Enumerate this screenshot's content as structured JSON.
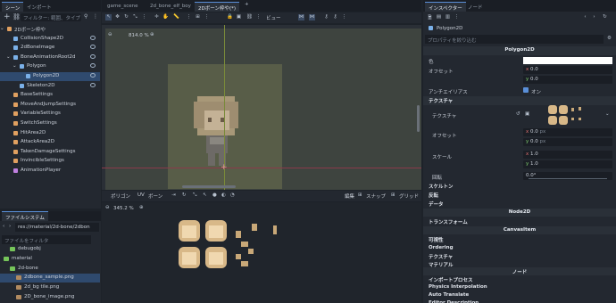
{
  "colors": {
    "accent": "#5a8fd8",
    "bg": "#1d2229",
    "panel": "#232830",
    "viewport": "#4a4f48",
    "selection": "#2f4a6e",
    "green_folder": "#76c55a"
  },
  "top_left_tabs": [
    "シーン",
    "インポート"
  ],
  "filter": {
    "placeholder": "フィルター: 範囲、タイプ"
  },
  "scene_tree": [
    {
      "label": "2Dボーン枠や",
      "depth": 0,
      "color": "#e0a060"
    },
    {
      "label": "CollisionShape2D",
      "depth": 1,
      "color": "#7ab0e8"
    },
    {
      "label": "2dBoneImage",
      "depth": 1,
      "color": "#7ab0e8"
    },
    {
      "label": "BoneAnimationRoot2d",
      "depth": 1,
      "color": "#7ab0e8"
    },
    {
      "label": "Polygon",
      "depth": 2,
      "color": "#7ab0e8"
    },
    {
      "label": "Polygon2D",
      "depth": 3,
      "color": "#7ab0e8",
      "selected": true
    },
    {
      "label": "Skeleton2D",
      "depth": 2,
      "color": "#7ab0e8"
    },
    {
      "label": "BaseSettings",
      "depth": 1,
      "color": "#e0a060"
    },
    {
      "label": "MoveAndJumpSettings",
      "depth": 1,
      "color": "#e0a060"
    },
    {
      "label": "VariableSettings",
      "depth": 1,
      "color": "#e0a060"
    },
    {
      "label": "SwitchSettings",
      "depth": 1,
      "color": "#e0a060"
    },
    {
      "label": "HitArea2D",
      "depth": 1,
      "color": "#e0a060"
    },
    {
      "label": "AttackArea2D",
      "depth": 1,
      "color": "#e0a060"
    },
    {
      "label": "TakenDamageSettings",
      "depth": 1,
      "color": "#e0a060"
    },
    {
      "label": "InvincibleSettings",
      "depth": 1,
      "color": "#e0a060"
    },
    {
      "label": "AnimationPlayer",
      "depth": 1,
      "color": "#c080e0"
    }
  ],
  "filesystem": {
    "title": "ファイルシステム",
    "path": "res://material/2d-bone/2dbon",
    "filter_placeholder": "ファイルをフィルタ",
    "items": [
      {
        "label": "debugobj",
        "depth": 1,
        "type": "folder"
      },
      {
        "label": "material",
        "depth": 0,
        "type": "folder"
      },
      {
        "label": "2d-bone",
        "depth": 1,
        "type": "folder"
      },
      {
        "label": "2dbone_sample.png",
        "depth": 2,
        "type": "file",
        "selected": true
      },
      {
        "label": "2d_bg tile.png",
        "depth": 2,
        "type": "file"
      },
      {
        "label": "2D_bone_image.png",
        "depth": 2,
        "type": "file"
      }
    ]
  },
  "editor_tabs": [
    "game_scene",
    "2d_bone_elf_boy",
    "2Dボーン枠や(*)"
  ],
  "editor_toolbar": {
    "view_label": "ビュー"
  },
  "viewport": {
    "zoom": "814.0 %"
  },
  "polygon_editor": {
    "tabs": [
      "ポリゴン",
      "UV",
      "ボーン"
    ],
    "edit_label": "編集",
    "snap_label": "スナップ",
    "grid_label": "グリッド",
    "zoom": "345.2 %"
  },
  "inspector": {
    "tabs": [
      "インスペクター",
      "ノード"
    ],
    "node_name": "Polygon2D",
    "filter_placeholder": "プロパティを絞り込む",
    "class_header": "Polygon2D",
    "color_label": "色",
    "offset_label": "オフセット",
    "offset_x": "0.0",
    "offset_y": "0.0",
    "antialias_label": "アンチエイリアス",
    "antialias_value": "オン",
    "texture_section": "テクスチャ",
    "texture_label": "テクスチャ",
    "tex_offset_label": "オフセット",
    "tex_offset_x": "0.0",
    "tex_offset_y": "0.0",
    "px_unit": "px",
    "scale_label": "スケール",
    "scale_x": "1.0",
    "scale_y": "1.0",
    "rotation_label": "回転",
    "rotation_value": "0.0°",
    "skeleton_section": "スケルトン",
    "invert_section": "反転",
    "data_section": "データ",
    "node2d_header": "Node2D",
    "transform_section": "トランスフォーム",
    "canvasitem_header": "CanvasItem",
    "visibility_section": "可視性",
    "ordering_section": "Ordering",
    "ci_texture_section": "テクスチャ",
    "material_section": "マテリアル",
    "node_header": "ノード",
    "process_section": "インポートプロセス",
    "physics_section": "Physics Interpolation",
    "autotranslate_section": "Auto Translate",
    "editor_desc_section": "Editor Description"
  }
}
